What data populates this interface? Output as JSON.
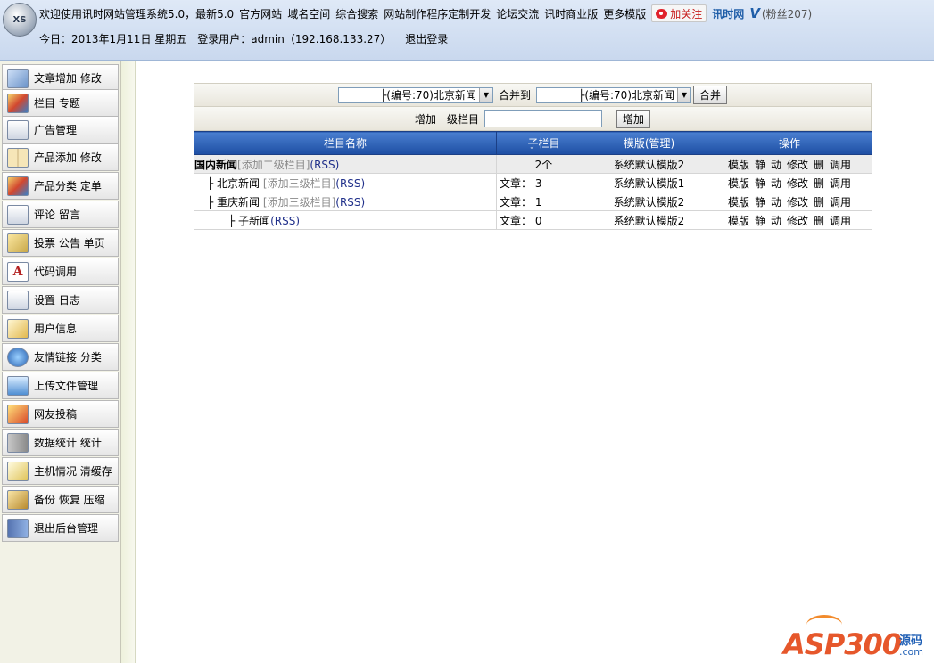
{
  "header": {
    "logo_text": "XS",
    "welcome": "欢迎使用讯时网站管理系统5.0，最新5.0",
    "links": [
      "官方网站",
      "域名空间",
      "综合搜索",
      "网站制作程序定制开发",
      "论坛交流",
      "讯时商业版",
      "更多模版"
    ],
    "follow_button": "加关注",
    "brand": "讯时网",
    "v_mark": "V",
    "fans": "(粉丝207)",
    "date_info": "今日：2013年1月11日 星期五",
    "login_user": "登录用户：admin（192.168.133.27）",
    "logout": "退出登录"
  },
  "sidebar": {
    "items": [
      {
        "label": "文章增加 修改",
        "icon": "article-edit-icon"
      },
      {
        "label": "栏目 专题",
        "icon": "column-topic-icon"
      },
      {
        "label": "广告管理",
        "icon": "ad-manage-icon"
      },
      {
        "label": "产品添加 修改",
        "icon": "product-book-icon"
      },
      {
        "label": "产品分类 定单",
        "icon": "product-category-icon"
      },
      {
        "label": "评论 留言",
        "icon": "comment-icon"
      },
      {
        "label": "投票 公告 单页",
        "icon": "vote-icon"
      },
      {
        "label": "代码调用",
        "icon": "code-letter-icon"
      },
      {
        "label": "设置 日志",
        "icon": "settings-icon"
      },
      {
        "label": "用户信息",
        "icon": "user-info-icon"
      },
      {
        "label": "友情链接 分类",
        "icon": "links-globe-icon"
      },
      {
        "label": "上传文件管理",
        "icon": "upload-icon"
      },
      {
        "label": "网友投稿",
        "icon": "contribution-icon"
      },
      {
        "label": "数据统计 统计",
        "icon": "stats-server-icon"
      },
      {
        "label": "主机情况 清缓存",
        "icon": "host-note-icon"
      },
      {
        "label": "备份 恢复 压缩",
        "icon": "backup-box-icon"
      },
      {
        "label": "退出后台管理",
        "icon": "exit-door-icon"
      }
    ]
  },
  "merge": {
    "from_value": "├(编号:70)北京新闻",
    "label": "合并到",
    "to_value": "├(编号:70)北京新闻",
    "button": "合并"
  },
  "add": {
    "label": "增加一级栏目",
    "input_value": "",
    "button": "增加"
  },
  "table": {
    "headers": [
      "栏目名称",
      "子栏目",
      "模版(管理)",
      "操作"
    ],
    "rows": [
      {
        "prefix": "",
        "name": "国内新闻",
        "add_link": "[添加二级栏目]",
        "rss": "(RSS)",
        "sub": "2个",
        "template": "系统默认模版2",
        "top": true
      },
      {
        "prefix": "├ ",
        "name": "北京新闻",
        "add_link": "[添加三级栏目]",
        "rss": "(RSS)",
        "sub": "文章： 3",
        "template": "系统默认模版1",
        "top": false
      },
      {
        "prefix": "├ ",
        "name": "重庆新闻",
        "add_link": "[添加三级栏目]",
        "rss": "(RSS)",
        "sub": "文章： 1",
        "template": "系统默认模版2",
        "top": false
      },
      {
        "prefix": "├ ",
        "name": "子新闻",
        "add_link": "",
        "rss": "(RSS)",
        "sub": "文章： 0",
        "template": "系统默认模版2",
        "top": false
      }
    ],
    "ops": [
      "模版",
      "静",
      "动",
      "修改",
      "删",
      "调用"
    ]
  },
  "watermark": {
    "main": "ASP300",
    "right": "源码",
    "com": ".com"
  }
}
